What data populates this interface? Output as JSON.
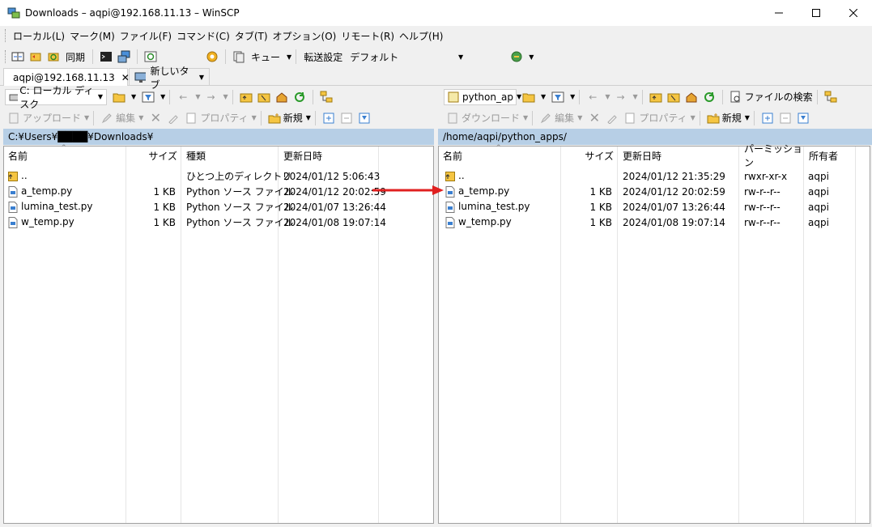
{
  "window": {
    "title": "Downloads – aqpi@192.168.11.13 – WinSCP"
  },
  "menu": [
    "ローカル(L)",
    "マーク(M)",
    "ファイル(F)",
    "コマンド(C)",
    "タブ(T)",
    "オプション(O)",
    "リモート(R)",
    "ヘルプ(H)"
  ],
  "toolbar": {
    "sync_label": "同期",
    "queue_label": "キュー",
    "transfer_label": "転送設定",
    "transfer_value": "デフォルト"
  },
  "tabs": [
    {
      "label": "aqpi@192.168.11.13"
    },
    {
      "label": "新しいタブ"
    }
  ],
  "left": {
    "drive": "C: ローカル ディスク",
    "upload": "アップロード",
    "edit": "編集",
    "properties": "プロパティ",
    "new": "新規",
    "path": "C:¥Users¥████¥Downloads¥",
    "headers": {
      "name": "名前",
      "size": "サイズ",
      "type": "種類",
      "modified": "更新日時"
    },
    "files": [
      {
        "name": "..",
        "size": "",
        "type": "ひとつ上のディレクトリ",
        "modified": "2024/01/12 5:06:43",
        "kind": "parent"
      },
      {
        "name": "a_temp.py",
        "size": "1 KB",
        "type": "Python ソース ファイル",
        "modified": "2024/01/12 20:02:59",
        "kind": "py"
      },
      {
        "name": "lumina_test.py",
        "size": "1 KB",
        "type": "Python ソース ファイル",
        "modified": "2024/01/07 13:26:44",
        "kind": "py"
      },
      {
        "name": "w_temp.py",
        "size": "1 KB",
        "type": "Python ソース ファイル",
        "modified": "2024/01/08 19:07:14",
        "kind": "py"
      }
    ]
  },
  "right": {
    "folder": "python_ap",
    "download": "ダウンロード",
    "edit": "編集",
    "properties": "プロパティ",
    "new": "新規",
    "find": "ファイルの検索",
    "path": "/home/aqpi/python_apps/",
    "headers": {
      "name": "名前",
      "size": "サイズ",
      "modified": "更新日時",
      "permissions": "パーミッション",
      "owner": "所有者"
    },
    "files": [
      {
        "name": "..",
        "size": "",
        "modified": "2024/01/12 21:35:29",
        "permissions": "rwxr-xr-x",
        "owner": "aqpi",
        "kind": "parent"
      },
      {
        "name": "a_temp.py",
        "size": "1 KB",
        "modified": "2024/01/12 20:02:59",
        "permissions": "rw-r--r--",
        "owner": "aqpi",
        "kind": "py"
      },
      {
        "name": "lumina_test.py",
        "size": "1 KB",
        "modified": "2024/01/07 13:26:44",
        "permissions": "rw-r--r--",
        "owner": "aqpi",
        "kind": "py"
      },
      {
        "name": "w_temp.py",
        "size": "1 KB",
        "modified": "2024/01/08 19:07:14",
        "permissions": "rw-r--r--",
        "owner": "aqpi",
        "kind": "py"
      }
    ]
  },
  "colors": {
    "path_bar": "#b7cfe6",
    "arrow": "#e02020",
    "folder": "#f5c542"
  }
}
